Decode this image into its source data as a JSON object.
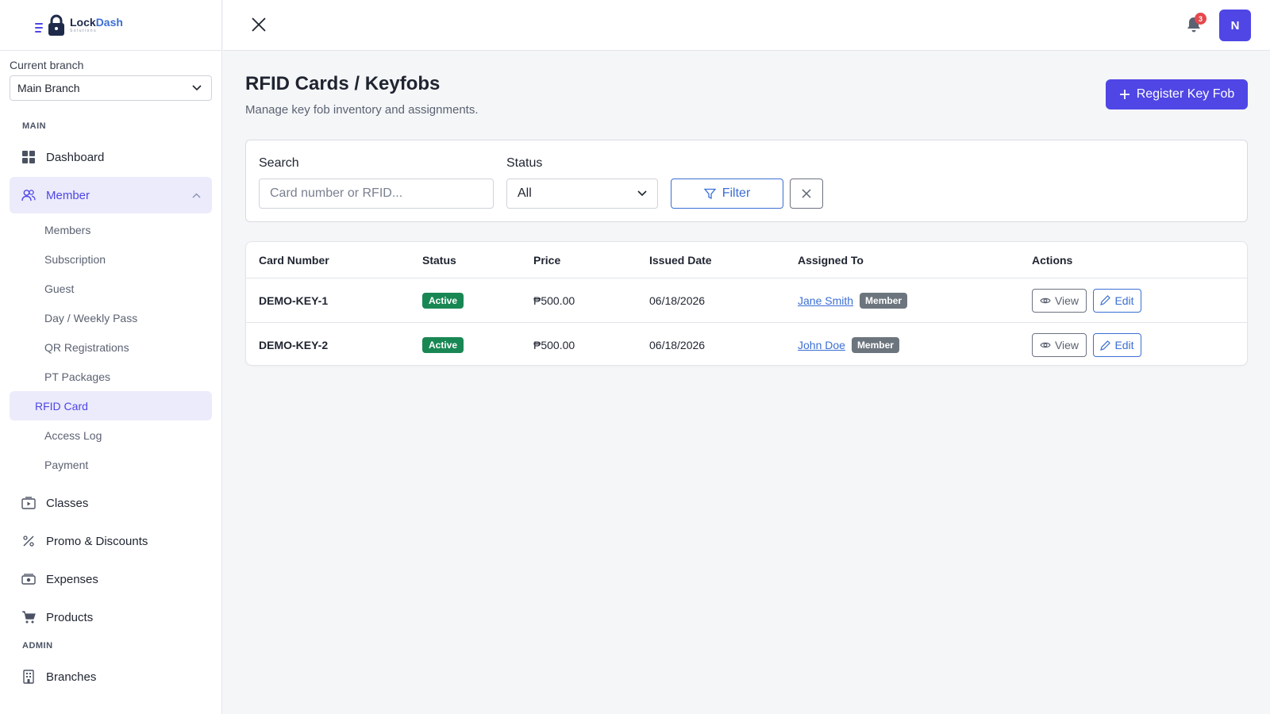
{
  "brand": {
    "name_part1": "Lock",
    "name_part2": "Dash",
    "subtitle": "Solutions"
  },
  "branch": {
    "label": "Current branch",
    "selected": "Main Branch"
  },
  "sidebar": {
    "section_main": "MAIN",
    "dashboard": "Dashboard",
    "member": "Member",
    "member_sub": [
      "Members",
      "Subscription",
      "Guest",
      "Day / Weekly Pass",
      "QR Registrations",
      "PT Packages",
      "RFID Card",
      "Access Log",
      "Payment"
    ],
    "classes": "Classes",
    "promo": "Promo & Discounts",
    "expenses": "Expenses",
    "products": "Products",
    "section_admin": "ADMIN",
    "branches": "Branches"
  },
  "topbar": {
    "notification_count": "3",
    "avatar_initial": "N"
  },
  "page": {
    "title": "RFID Cards / Keyfobs",
    "subtitle": "Manage key fob inventory and assignments.",
    "register_label": "Register Key Fob"
  },
  "filters": {
    "search_label": "Search",
    "search_placeholder": "Card number or RFID...",
    "status_label": "Status",
    "status_value": "All",
    "filter_label": "Filter"
  },
  "table": {
    "headers": [
      "Card Number",
      "Status",
      "Price",
      "Issued Date",
      "Assigned To",
      "Actions"
    ],
    "rows": [
      {
        "card": "DEMO-KEY-1",
        "status": "Active",
        "price": "₱500.00",
        "date": "06/18/2026",
        "assigned": "Jane Smith",
        "role": "Member"
      },
      {
        "card": "DEMO-KEY-2",
        "status": "Active",
        "price": "₱500.00",
        "date": "06/18/2026",
        "assigned": "John Doe",
        "role": "Member"
      }
    ],
    "view_label": "View",
    "edit_label": "Edit"
  },
  "colors": {
    "accent": "#4f46e5",
    "link": "#3b6fd4",
    "active": "#198754",
    "member_badge": "#6c757d",
    "notify": "#e5484d"
  }
}
